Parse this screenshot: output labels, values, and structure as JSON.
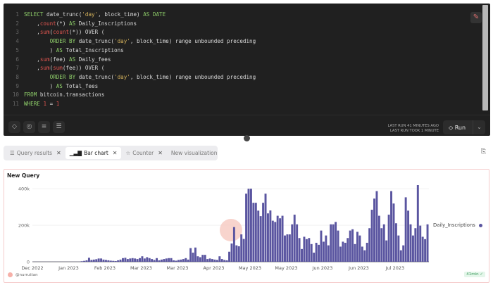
{
  "editor": {
    "lines": [
      [
        [
          "kw",
          "SELECT "
        ],
        [
          "",
          "date_trunc("
        ],
        [
          "str",
          "'day'"
        ],
        [
          "",
          ", block_time) "
        ],
        [
          "kw",
          "AS DATE"
        ]
      ],
      [
        [
          "",
          "    ,"
        ],
        [
          "fn",
          "count"
        ],
        [
          "",
          "(*) "
        ],
        [
          "kw",
          "AS "
        ],
        [
          "",
          "Daily_Inscriptions"
        ]
      ],
      [
        [
          "",
          "    ,"
        ],
        [
          "fn",
          "sum"
        ],
        [
          "",
          "("
        ],
        [
          "fn",
          "count"
        ],
        [
          "",
          "(*)) OVER ("
        ]
      ],
      [
        [
          "kw",
          "        ORDER BY "
        ],
        [
          "",
          "date_trunc("
        ],
        [
          "str",
          "'day'"
        ],
        [
          "",
          ", block_time) range unbounded preceding"
        ]
      ],
      [
        [
          "",
          "        ) "
        ],
        [
          "kw",
          "AS "
        ],
        [
          "",
          "Total_Inscriptions"
        ]
      ],
      [
        [
          "",
          "    ,"
        ],
        [
          "fn",
          "sum"
        ],
        [
          "",
          "(fee) "
        ],
        [
          "kw",
          "AS "
        ],
        [
          "",
          "Daily_fees"
        ]
      ],
      [
        [
          "",
          "    ,"
        ],
        [
          "fn",
          "sum"
        ],
        [
          "",
          "("
        ],
        [
          "fn",
          "sum"
        ],
        [
          "",
          "(fee)) OVER ("
        ]
      ],
      [
        [
          "kw",
          "        ORDER BY "
        ],
        [
          "",
          "date_trunc("
        ],
        [
          "str",
          "'day'"
        ],
        [
          "",
          ", block_time) range unbounded preceding"
        ]
      ],
      [
        [
          "",
          "        ) "
        ],
        [
          "kw",
          "AS "
        ],
        [
          "",
          "Total_fees"
        ]
      ],
      [
        [
          "kw",
          "FROM "
        ],
        [
          "",
          "bitcoin.transactions"
        ]
      ],
      [
        [
          "kw",
          "WHERE "
        ],
        [
          "fn",
          "1"
        ],
        [
          "",
          " = "
        ],
        [
          "fn",
          "1"
        ]
      ]
    ]
  },
  "toolbar": {
    "last_run": "LAST RUN 41 MINUTES AGO",
    "last_run_took": "LAST RUN TOOK 1 MINUTE",
    "run_label": "Run"
  },
  "tabs": [
    {
      "label": "Query results",
      "icon": "list-icon"
    },
    {
      "label": "Bar chart",
      "icon": "bar-chart-icon",
      "active": true
    },
    {
      "label": "Counter",
      "icon": "star-icon"
    },
    {
      "label": "New visualization"
    }
  ],
  "card": {
    "title": "New Query",
    "author": "@nurruttan",
    "age": "41min"
  },
  "chart_data": {
    "type": "bar",
    "title": "New Query",
    "xlabel": "",
    "ylabel": "",
    "ylim": [
      0,
      420000
    ],
    "yticks": [
      0,
      200000,
      400000
    ],
    "ytick_labels": [
      "0",
      "200k",
      "400k"
    ],
    "xtick_labels": [
      "Dec 2022",
      "Jan 2023",
      "Feb 2023",
      "Mar 2023",
      "Mar 2023",
      "Apr 2023",
      "May 2023",
      "May 2023",
      "Jun 2023",
      "Jun 2023",
      "Jul 2023"
    ],
    "xtick_every_days": 15,
    "legend": "right",
    "bar_color": "#5a55a0",
    "series": [
      {
        "name": "Daily_Inscriptions",
        "values_k": [
          0.5,
          0.5,
          0.5,
          0.5,
          0.5,
          0.5,
          0.5,
          0.5,
          0.5,
          0.5,
          0.5,
          0.5,
          0.5,
          0.5,
          0.5,
          0.5,
          0.5,
          0.5,
          0.5,
          0.5,
          3,
          5,
          8,
          22,
          10,
          12,
          14,
          18,
          18,
          12,
          10,
          8,
          6,
          5,
          4,
          8,
          12,
          20,
          22,
          15,
          18,
          20,
          18,
          15,
          20,
          30,
          18,
          25,
          20,
          15,
          10,
          20,
          8,
          12,
          15,
          18,
          20,
          20,
          8,
          6,
          10,
          12,
          15,
          20,
          12,
          75,
          50,
          78,
          30,
          25,
          38,
          38,
          15,
          18,
          15,
          12,
          10,
          30,
          15,
          10,
          8,
          55,
          100,
          190,
          90,
          85,
          150,
          125,
          373,
          400,
          400,
          323,
          323,
          280,
          250,
          323,
          373,
          265,
          281,
          225,
          218,
          252,
          238,
          252,
          144,
          150,
          150,
          205,
          258,
          205,
          130,
          70,
          137,
          124,
          130,
          97,
          50,
          104,
          93,
          171,
          110,
          144,
          90,
          205,
          205,
          218,
          171,
          83,
          110,
          104,
          130,
          171,
          178,
          97,
          164,
          144,
          83,
          63,
          104,
          184,
          285,
          346,
          387,
          252,
          184,
          205,
          117,
          258,
          387,
          319,
          211,
          144,
          63,
          90,
          353,
          280,
          205,
          144,
          184,
          420,
          198,
          137,
          124,
          205
        ]
      }
    ]
  }
}
